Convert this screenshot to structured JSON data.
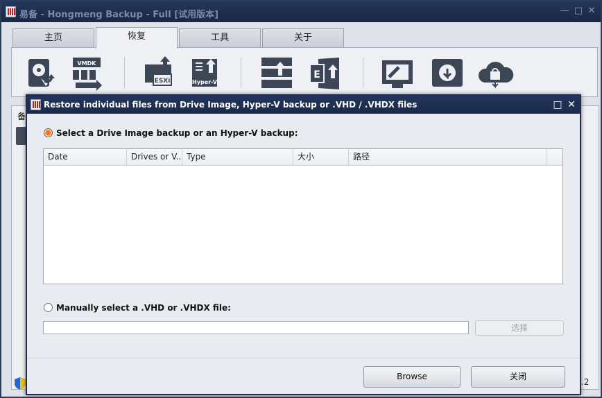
{
  "window": {
    "title": "易备 - Hongmeng Backup - Full [试用版本]",
    "controls": [
      "—",
      "□",
      "✕"
    ]
  },
  "tabs": [
    {
      "label": "主页",
      "active": false
    },
    {
      "label": "恢复",
      "active": true
    },
    {
      "label": "工具",
      "active": false
    },
    {
      "label": "关于",
      "active": false
    }
  ],
  "ribbon": {
    "icons": [
      "drive-image-restore-icon",
      "vmdk-restore-icon",
      "esxi-restore-icon",
      "hyper-v-restore-icon",
      "server-restore-icon",
      "exchange-restore-icon",
      "ftp-restore-icon",
      "disk-restore-icon",
      "cloud-restore-icon"
    ],
    "esxi_label": "ESXi",
    "hyperv_label": "Hyper-V",
    "vmdk_label": "VMDK"
  },
  "background": {
    "header_text": "备",
    "version_stub": ".2"
  },
  "dialog": {
    "title": "Restore individual files from Drive Image, Hyper-V backup or .VHD / .VHDX files",
    "option1_label": "Select a Drive Image backup or an Hyper-V backup:",
    "option1_selected": true,
    "columns": [
      "Date",
      "Drives or V...",
      "Type",
      "大小",
      "路径"
    ],
    "rows": [],
    "option2_label": "Manually select a .VHD or .VHDX file:",
    "option2_selected": false,
    "path_value": "",
    "choose_label": "选择",
    "browse_label": "Browse",
    "close_label": "关闭"
  },
  "colors": {
    "titlebar": "#1f2f4f",
    "accent_radio": "#e9782f",
    "brand_red": "#b6251d"
  }
}
